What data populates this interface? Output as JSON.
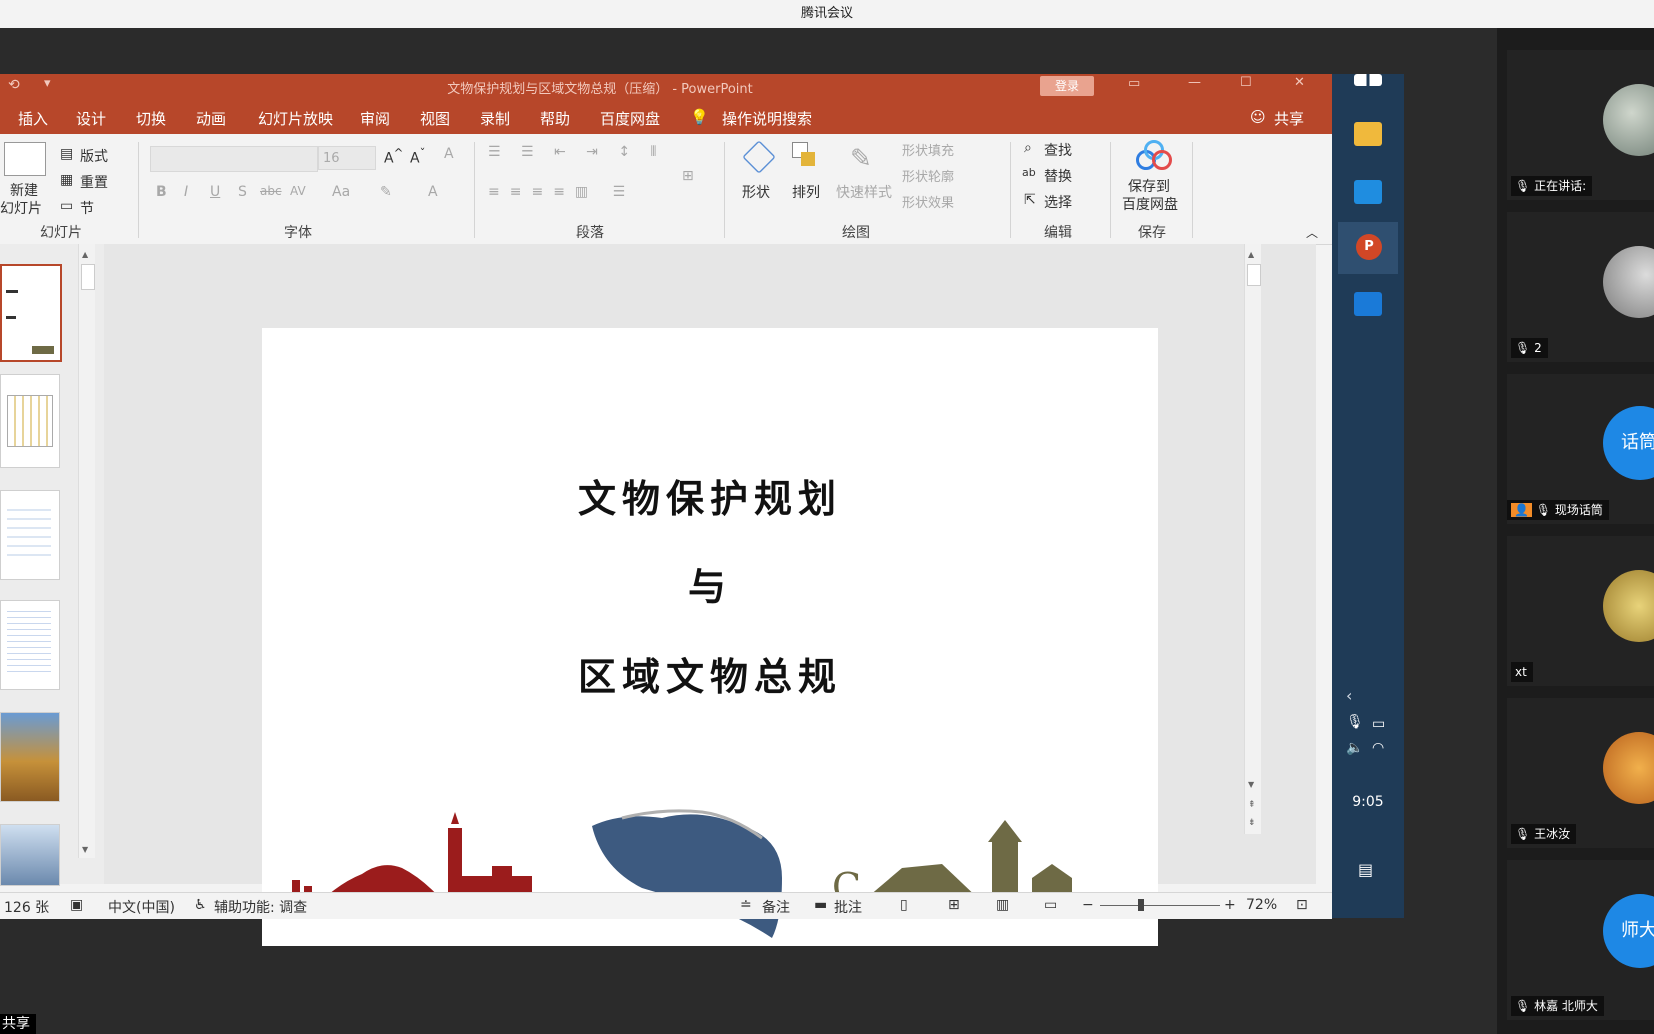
{
  "meeting_app": {
    "title": "腾讯会议"
  },
  "ppt": {
    "window_title": "文物保护规划与区域文物总规（压缩） - PowerPoint",
    "signin": "登录",
    "tabs": [
      "插入",
      "设计",
      "切换",
      "动画",
      "幻灯片放映",
      "审阅",
      "视图",
      "录制",
      "帮助",
      "百度网盘"
    ],
    "tell_me": "操作说明搜索",
    "share": "共享",
    "ribbon": {
      "slides": {
        "new_slide_line1": "新建",
        "new_slide_line2": "幻灯片",
        "layout": "版式",
        "reset": "重置",
        "section": "节",
        "label": "幻灯片"
      },
      "font": {
        "size": "16",
        "label": "字体",
        "bold": "B",
        "italic": "I",
        "underline": "U",
        "shadow": "S",
        "strike": "abc",
        "spacing": "AV",
        "case": "Aa",
        "color": "A"
      },
      "paragraph": {
        "label": "段落"
      },
      "drawing": {
        "shape": "形状",
        "arrange": "排列",
        "quick_styles": "快速样式",
        "shape_fill": "形状填充",
        "shape_outline": "形状轮廓",
        "shape_effect": "形状效果",
        "label": "绘图"
      },
      "editing": {
        "find": "查找",
        "replace": "替换",
        "select": "选择",
        "label": "编辑"
      },
      "save": {
        "line1": "保存到",
        "line2": "百度网盘",
        "label": "保存"
      }
    },
    "slide": {
      "line1": "文物保护规划",
      "line2": "与",
      "line3": "区域文物总规"
    },
    "status": {
      "count": "126 张",
      "language": "中文(中国)",
      "accessibility": "辅助功能: 调查",
      "notes": "备注",
      "comments": "批注",
      "zoom": "72%"
    }
  },
  "taskbar": {
    "time": "9:05"
  },
  "participants": [
    {
      "label": "正在讲话:",
      "avatar": "photo"
    },
    {
      "label": "2",
      "avatar": "photo"
    },
    {
      "label": "现场话筒",
      "avatar_text": "话筒"
    },
    {
      "label": "xt",
      "avatar": "photo"
    },
    {
      "label": "王冰汝",
      "avatar": "photo"
    },
    {
      "label": "林嘉 北师大",
      "avatar_text": "师大"
    }
  ],
  "share_tag": "共享",
  "colors": {
    "ppt_red": "#b7472a",
    "taskbar_blue": "#1f3b57",
    "accent_blue": "#1e88e5",
    "silhouette_red": "#9b1c1c",
    "silhouette_olive": "#6e6a45",
    "map_blue": "#3d5a80"
  }
}
